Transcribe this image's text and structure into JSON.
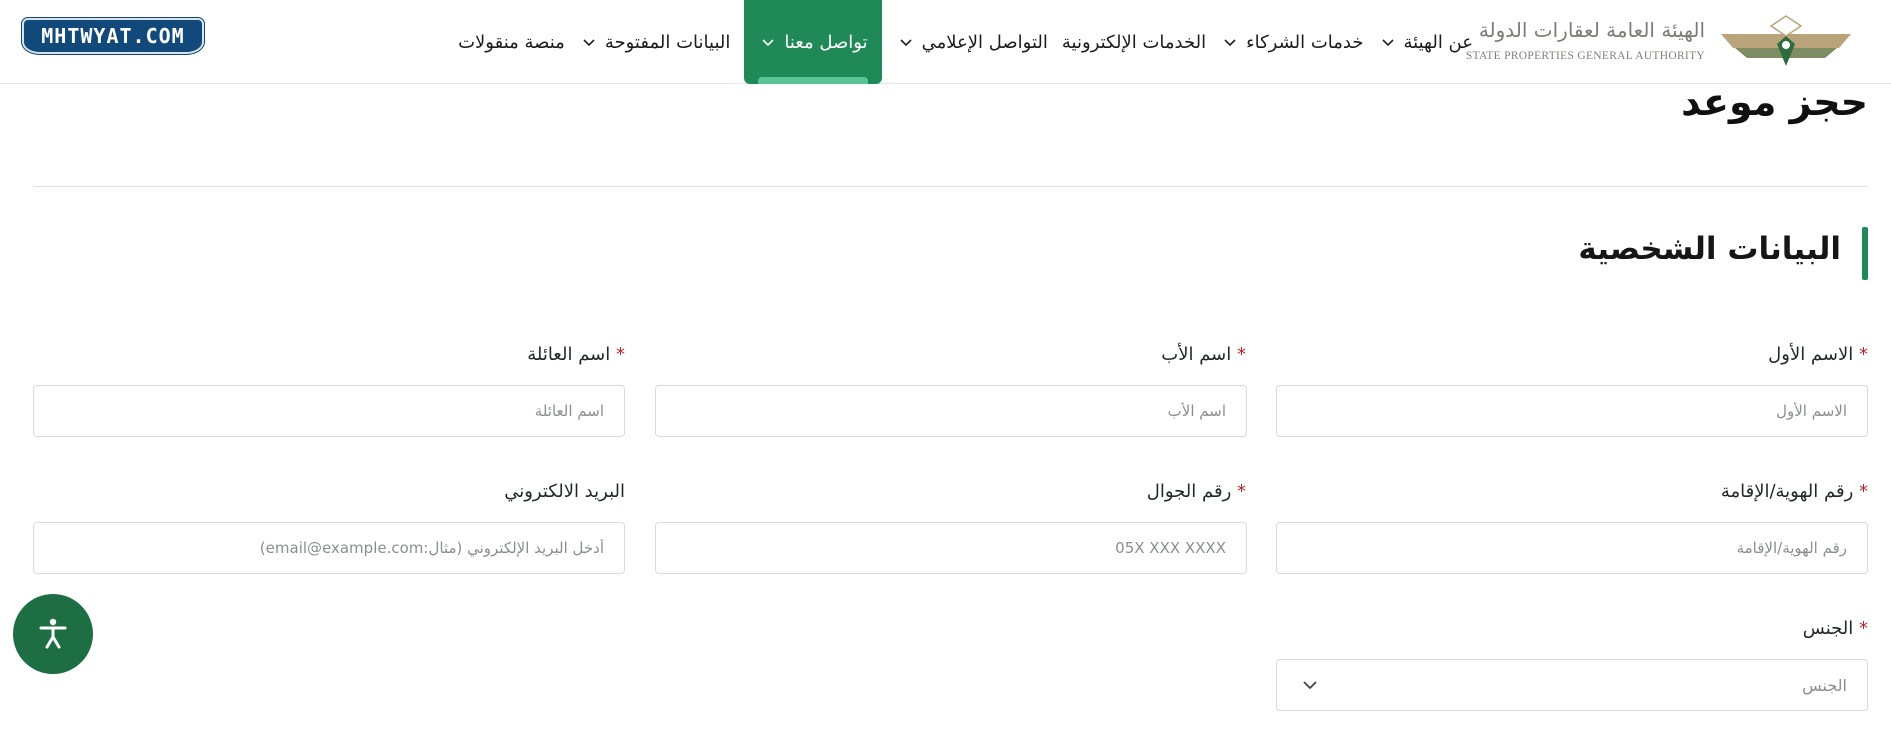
{
  "header": {
    "logo": {
      "arabic": "الهيئة العامة لعقارات الدولة",
      "english": "STATE PROPERTIES GENERAL AUTHORITY"
    },
    "nav": [
      {
        "label": "عن الهيئة",
        "has_dropdown": true,
        "active": false
      },
      {
        "label": "خدمات الشركاء",
        "has_dropdown": true,
        "active": false
      },
      {
        "label": "الخدمات الإلكترونية",
        "has_dropdown": false,
        "active": false
      },
      {
        "label": "التواصل الإعلامي",
        "has_dropdown": true,
        "active": false
      },
      {
        "label": "تواصل معنا",
        "has_dropdown": true,
        "active": true
      },
      {
        "label": "البيانات المفتوحة",
        "has_dropdown": true,
        "active": false
      },
      {
        "label": "منصة منقولات",
        "has_dropdown": false,
        "active": false
      }
    ],
    "watermark": "MHTWYAT.COM"
  },
  "page": {
    "title": "حجز موعد",
    "section_title": "البيانات الشخصية"
  },
  "form": {
    "required_mark": "*",
    "first_name": {
      "label": "الاسم الأول",
      "placeholder": "الاسم الأول",
      "required": true
    },
    "father_name": {
      "label": "اسم الأب",
      "placeholder": "اسم الأب",
      "required": true
    },
    "family_name": {
      "label": "اسم العائلة",
      "placeholder": "اسم العائلة",
      "required": true
    },
    "id_number": {
      "label": "رقم الهوية/الإقامة",
      "placeholder": "رقم الهوية/الإقامة",
      "required": true
    },
    "mobile": {
      "label": "رقم الجوال",
      "placeholder": "05X XXX XXXX",
      "required": true
    },
    "email": {
      "label": "البريد الالكتروني",
      "placeholder": "أدخل البريد الإلكتروني (مثال:email@example.com)",
      "required": false
    },
    "gender": {
      "label": "الجنس",
      "placeholder": "الجنس",
      "required": true
    }
  },
  "colors": {
    "accent": "#1f8a58",
    "accent_light": "#59c597",
    "required": "#c0212c",
    "a11y_button": "#1e6e43",
    "badge": "#10497a"
  },
  "icons": {
    "accessibility": "accessibility-icon",
    "dropdown": "chevron-down-icon"
  }
}
